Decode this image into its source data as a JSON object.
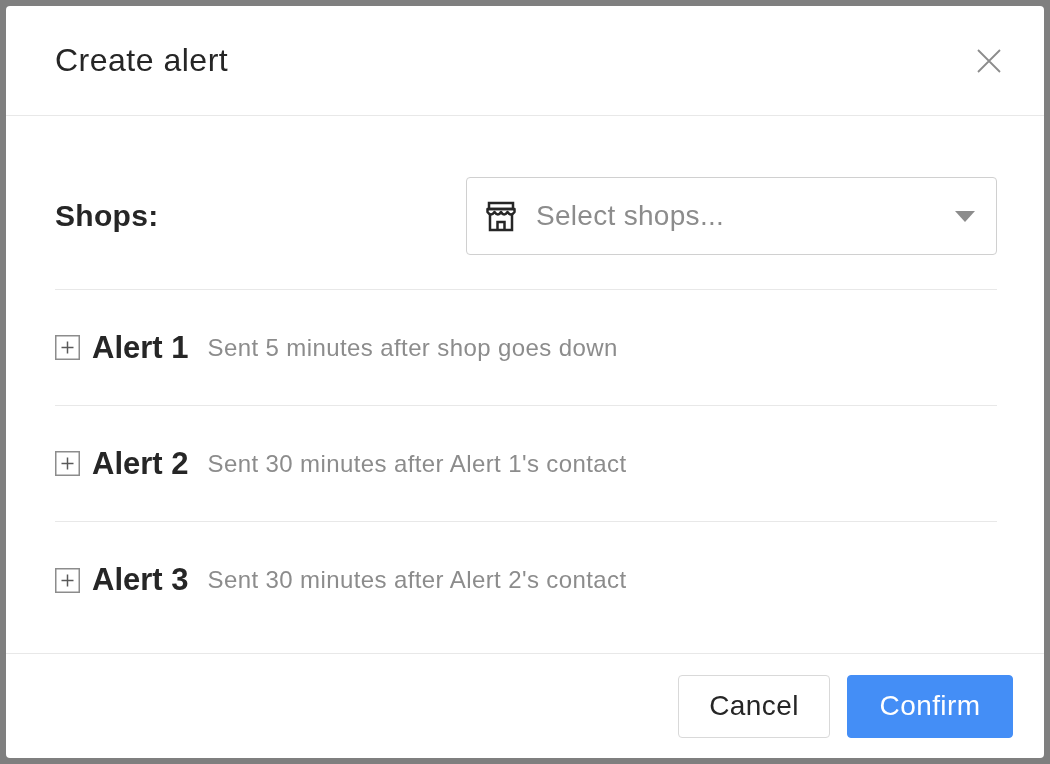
{
  "dialog": {
    "title": "Create alert"
  },
  "shops_field": {
    "label": "Shops:",
    "placeholder": "Select shops..."
  },
  "alerts": [
    {
      "name": "Alert 1",
      "description": "Sent 5 minutes after shop goes down",
      "expanded": false
    },
    {
      "name": "Alert 2",
      "description": "Sent 30 minutes after Alert 1's contact",
      "expanded": false
    },
    {
      "name": "Alert 3",
      "description": "Sent 30 minutes after Alert 2's contact",
      "expanded": false
    }
  ],
  "buttons": [
    {
      "label": "Cancel",
      "kind": "secondary"
    },
    {
      "label": "Confirm",
      "kind": "primary"
    }
  ]
}
